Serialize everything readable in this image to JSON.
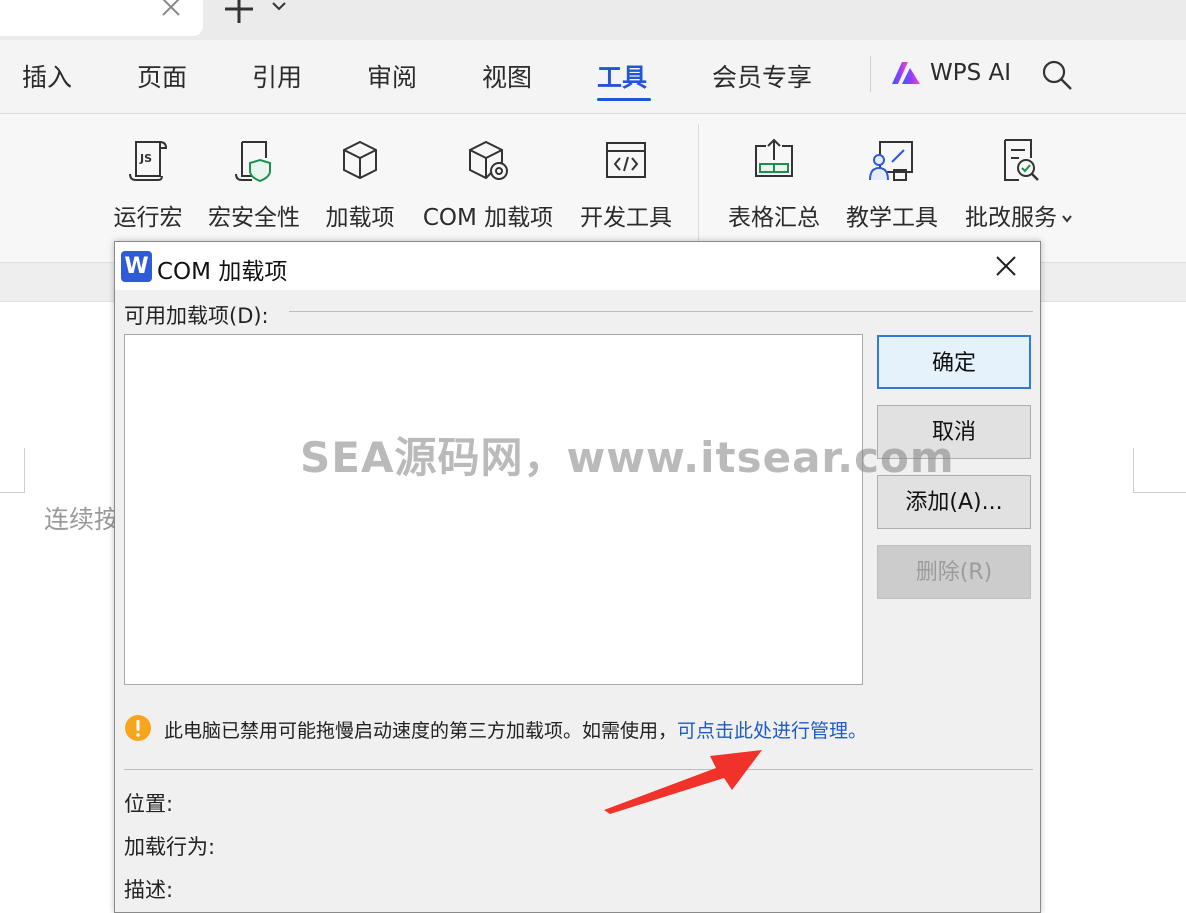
{
  "tabbar": {
    "plus": "+"
  },
  "menu": {
    "items": [
      "插入",
      "页面",
      "引用",
      "审阅",
      "视图",
      "工具",
      "会员专享"
    ],
    "active": "工具",
    "wps_ai": "WPS AI"
  },
  "toolbar": {
    "items": [
      "运行宏",
      "宏安全性",
      "加载项",
      "COM 加载项",
      "开发工具",
      "表格汇总",
      "教学工具",
      "批改服务"
    ]
  },
  "document": {
    "text": "连续按"
  },
  "dialog": {
    "app_icon": "W",
    "title": "COM 加载项",
    "group_label": "可用加载项(D):",
    "buttons": {
      "ok": "确定",
      "cancel": "取消",
      "add": "添加(A)...",
      "remove": "删除(R)"
    },
    "warning": {
      "text": "此电脑已禁用可能拖慢启动速度的第三方加载项。如需使用，",
      "link": "可点击此处进行管理。"
    },
    "fields": {
      "location": "位置:",
      "load_behavior": "加载行为:",
      "description": "描述:"
    }
  },
  "watermark": "SEA源码网，www.itsear.com",
  "colors": {
    "accent": "#2355d6",
    "link": "#1f5cc7",
    "warning": "#f7a51c",
    "arrow": "#f0322a"
  }
}
